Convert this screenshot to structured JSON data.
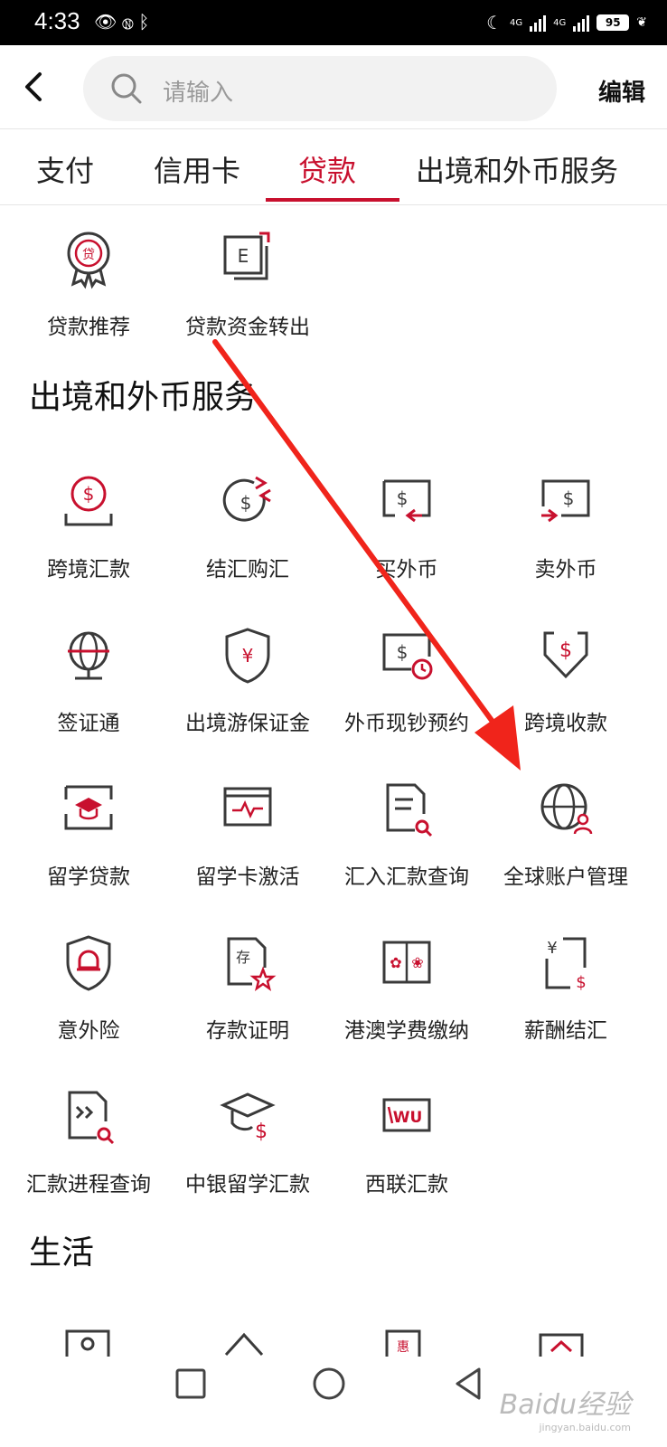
{
  "status_bar": {
    "time": "4:33",
    "battery": "95",
    "net1": "4G",
    "net2": "4G"
  },
  "header": {
    "search_placeholder": "请输入",
    "edit_label": "编辑"
  },
  "tabs": [
    {
      "label": "支付"
    },
    {
      "label": "信用卡"
    },
    {
      "label": "贷款",
      "active": true
    },
    {
      "label": "出境和外币服务"
    }
  ],
  "loan_items": [
    {
      "label": "贷款推荐",
      "icon": "loan-recommend-icon"
    },
    {
      "label": "贷款资金转出",
      "icon": "loan-transfer-out-icon"
    }
  ],
  "sections": {
    "foreign": {
      "title": "出境和外币服务"
    },
    "life": {
      "title": "生活"
    }
  },
  "foreign_items": [
    {
      "label": "跨境汇款",
      "icon": "cross-border-remit-icon"
    },
    {
      "label": "结汇购汇",
      "icon": "fx-exchange-icon"
    },
    {
      "label": "买外币",
      "icon": "buy-fx-icon"
    },
    {
      "label": "卖外币",
      "icon": "sell-fx-icon"
    },
    {
      "label": "签证通",
      "icon": "visa-globe-icon"
    },
    {
      "label": "出境游保证金",
      "icon": "shield-yen-icon"
    },
    {
      "label": "外币现钞预约",
      "icon": "cash-reservation-icon"
    },
    {
      "label": "跨境收款",
      "icon": "cross-border-receive-icon"
    },
    {
      "label": "留学贷款",
      "icon": "study-loan-icon"
    },
    {
      "label": "留学卡激活",
      "icon": "study-card-icon"
    },
    {
      "label": "汇入汇款查询",
      "icon": "inward-remit-query-icon"
    },
    {
      "label": "全球账户管理",
      "icon": "global-account-icon"
    },
    {
      "label": "意外险",
      "icon": "accident-insurance-icon"
    },
    {
      "label": "存款证明",
      "icon": "deposit-certificate-icon"
    },
    {
      "label": "港澳学费缴纳",
      "icon": "hk-macau-tuition-icon"
    },
    {
      "label": "薪酬结汇",
      "icon": "salary-settlement-icon"
    },
    {
      "label": "汇款进程查询",
      "icon": "remit-progress-icon"
    },
    {
      "label": "中银留学汇款",
      "icon": "boc-study-remit-icon"
    },
    {
      "label": "西联汇款",
      "icon": "western-union-icon"
    }
  ],
  "watermark": {
    "text": "Baidu经验",
    "sub": "jingyan.baidu.com"
  },
  "colors": {
    "accent": "#c8102e",
    "arrow": "#f0241b",
    "icon_stroke": "#3a3a3a"
  }
}
